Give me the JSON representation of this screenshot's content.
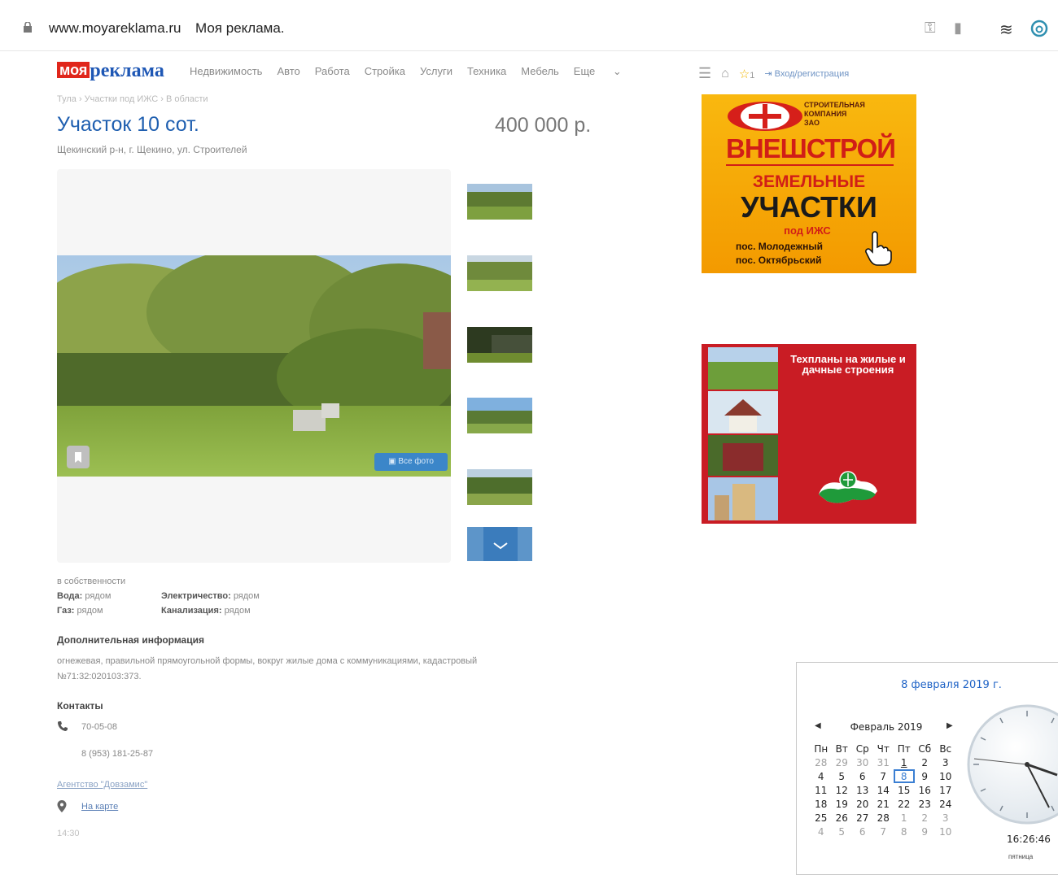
{
  "browser": {
    "url": "www.moyareklama.ru",
    "tab_title": "Моя реклама."
  },
  "header": {
    "logo_part1": "моя",
    "logo_part2": "реклама",
    "nav": [
      "Недвижимость",
      "Авто",
      "Работа",
      "Стройка",
      "Услуги",
      "Техника",
      "Мебель",
      "Еще"
    ],
    "favorites_count": "1",
    "login_label": "Вход/регистрация"
  },
  "listing": {
    "breadcrumb": "Тула › Участки под ИЖС › В области",
    "title": "Участок 10 сот.",
    "price": "400 000 р.",
    "address": "Щекинский р-н, г. Щекино, ул. Строителей",
    "photo_button": "Все фото",
    "ownership": "в собственности",
    "utilities": [
      {
        "label": "Вода:",
        "value": "рядом"
      },
      {
        "label": "Электричество:",
        "value": "рядом"
      },
      {
        "label": "Газ:",
        "value": "рядом"
      },
      {
        "label": "Канализация:",
        "value": "рядом"
      }
    ],
    "extra_title": "Дополнительная информация",
    "extra_text_line1": "огнежевая, правильной прямоугольной формы, вокруг жилые дома с коммуникациями, кадастровый",
    "extra_text_line2": "№71:32:020103:373.",
    "contacts_title": "Контакты",
    "phone1": "70-05-08",
    "phone2": "8 (953) 181-25-87",
    "agency": "Агентство \"Довзамис\"",
    "map_link": "На карте",
    "time": "14:30"
  },
  "ads": {
    "ad1": {
      "company_line1": "СТРОИТЕЛЬНАЯ",
      "company_line2": "КОМПАНИЯ",
      "company_line3": "ЗАО",
      "brand": "ВНЕШСТРОЙ",
      "line1": "ЗЕМЕЛЬНЫЕ",
      "line2": "УЧАСТКИ",
      "line3": "под ИЖС",
      "line4": "пос. Молодежный",
      "line5": "пос. Октябрьский"
    },
    "ad2": {
      "title": "Техпланы на жилые и дачные строения"
    }
  },
  "calendar": {
    "date_title": "8 февраля 2019 г.",
    "month_label": "Февраль 2019",
    "weekdays": [
      "Пн",
      "Вт",
      "Ср",
      "Чт",
      "Пт",
      "Сб",
      "Вс"
    ],
    "weeks": [
      [
        "28",
        "29",
        "30",
        "31",
        "1",
        "2",
        "3"
      ],
      [
        "4",
        "5",
        "6",
        "7",
        "8",
        "9",
        "10"
      ],
      [
        "11",
        "12",
        "13",
        "14",
        "15",
        "16",
        "17"
      ],
      [
        "18",
        "19",
        "20",
        "21",
        "22",
        "23",
        "24"
      ],
      [
        "25",
        "26",
        "27",
        "28",
        "1",
        "2",
        "3"
      ],
      [
        "4",
        "5",
        "6",
        "7",
        "8",
        "9",
        "10"
      ]
    ],
    "clock_time": "16:26:46",
    "clock_day": "пятница"
  }
}
